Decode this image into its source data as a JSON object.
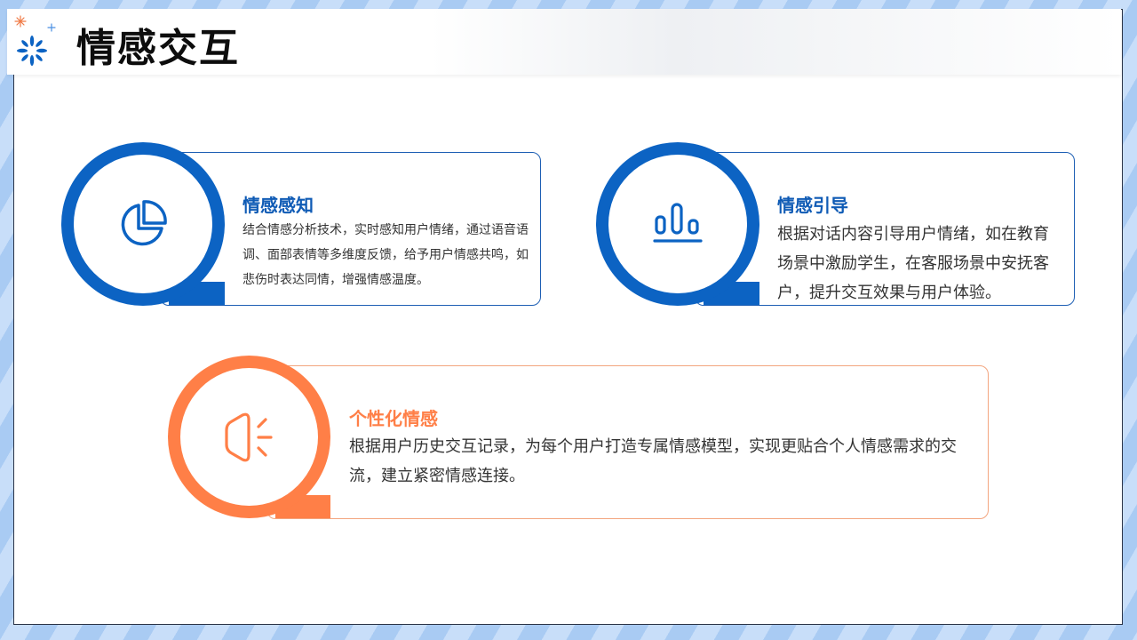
{
  "title": "情感交互",
  "colors": {
    "primary": "#0c63c3",
    "accent": "#ff7f47"
  },
  "logo": {
    "icon": "sparkle-icon"
  },
  "cards": [
    {
      "heading": "情感感知",
      "body": "结合情感分析技术，实时感知用户情绪，通过语音语调、面部表情等多维度反馈，给予用户情感共鸣，如悲伤时表达同情，增强情感温度。",
      "icon": "pie-chart-icon"
    },
    {
      "heading": "情感引导",
      "body": "根据对话内容引导用户情绪，如在教育场景中激励学生，在客服场景中安抚客户，提升交互效果与用户体验。",
      "icon": "bar-chart-icon"
    },
    {
      "heading": "个性化情感",
      "body": "根据用户历史交互记录，为每个用户打造专属情感模型，实现更贴合个人情感需求的交流，建立紧密情感连接。",
      "icon": "speaker-icon"
    }
  ]
}
